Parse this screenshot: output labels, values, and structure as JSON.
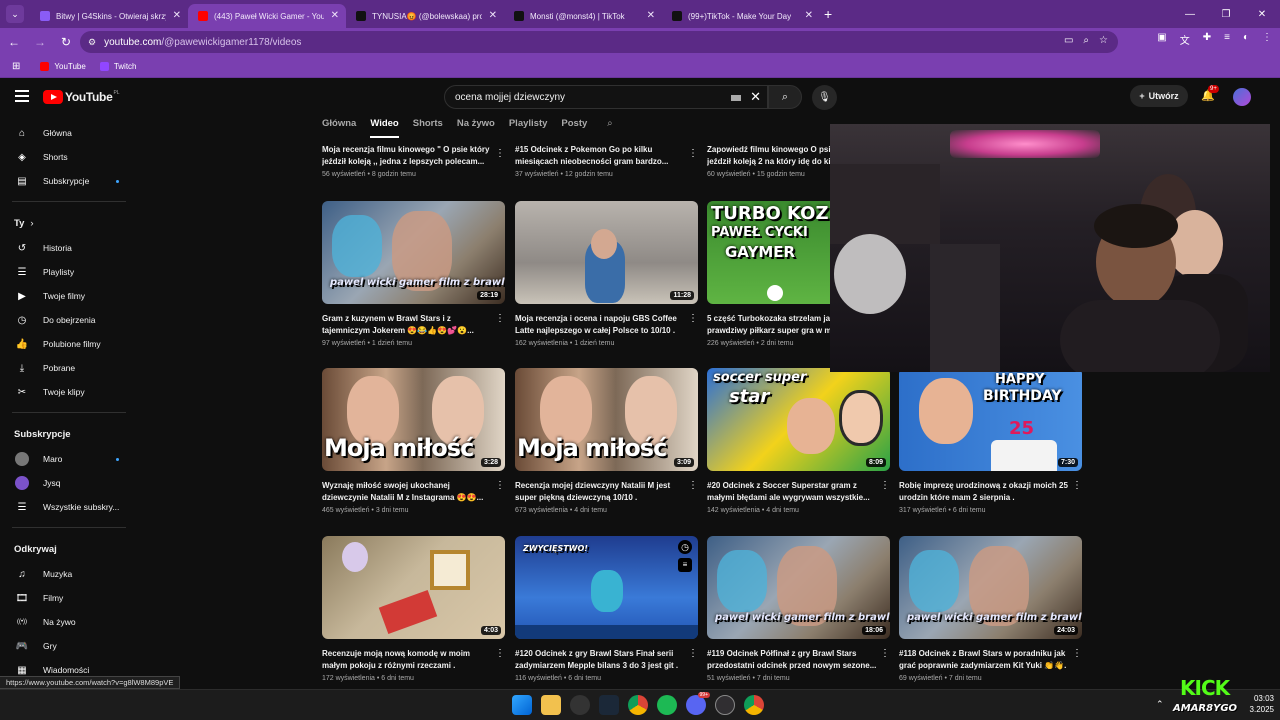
{
  "browser": {
    "tabs": [
      {
        "title": "Bitwy | G4Skins - Otwieraj skrzy",
        "fav_color": "#8a5cf6",
        "active": false
      },
      {
        "title": "(443) Paweł Wicki Gamer - YouT",
        "fav_color": "#ff0000",
        "active": true
      },
      {
        "title": "TYNUSIA😡 (@bolewskaa) pro",
        "fav_color": "#111111",
        "active": false
      },
      {
        "title": "Monsti (@monst4) | TikTok",
        "fav_color": "#111111",
        "active": false
      },
      {
        "title": "(99+)TikTok - Make Your Day",
        "fav_color": "#111111",
        "active": false
      }
    ],
    "new_tab": "+",
    "url_main": "youtube.com",
    "url_path": "/@pawewickigamer1178/videos",
    "bookmarks": [
      {
        "label": "YouTube",
        "color": "#ff0000"
      },
      {
        "label": "Twitch",
        "color": "#9146ff"
      }
    ]
  },
  "header": {
    "logo": "YouTube",
    "country": "PL",
    "search_value": "ocena mojjej dziewczyny",
    "create_label": "Utwórz",
    "notif_badge": "9+"
  },
  "sidebar": {
    "main": [
      {
        "label": "Główna",
        "icon": "⌂"
      },
      {
        "label": "Shorts",
        "icon": "◈"
      },
      {
        "label": "Subskrypcje",
        "icon": "▤"
      }
    ],
    "you_header": "Ty",
    "you": [
      {
        "label": "Historia",
        "icon": "↺"
      },
      {
        "label": "Playlisty",
        "icon": "☰"
      },
      {
        "label": "Twoje filmy",
        "icon": "▶"
      },
      {
        "label": "Do obejrzenia",
        "icon": "◷"
      },
      {
        "label": "Polubione filmy",
        "icon": "👍"
      },
      {
        "label": "Pobrane",
        "icon": "⤓"
      },
      {
        "label": "Twoje klipy",
        "icon": "✂"
      }
    ],
    "subs_header": "Subskrypcje",
    "subs": [
      {
        "label": "Maro",
        "color": "#777777"
      },
      {
        "label": "Jysq",
        "color": "#7b52c9"
      },
      {
        "label": "Wszystkie subskry...",
        "color": ""
      }
    ],
    "explore_header": "Odkrywaj",
    "explore": [
      {
        "label": "Muzyka",
        "icon": "♫"
      },
      {
        "label": "Filmy",
        "icon": "🎞"
      },
      {
        "label": "Na żywo",
        "icon": "((•))"
      },
      {
        "label": "Gry",
        "icon": "🎮"
      },
      {
        "label": "Wiadomości",
        "icon": "▦"
      },
      {
        "label": "Sport",
        "icon": "🏆"
      }
    ]
  },
  "channel_tabs": [
    "Główna",
    "Wideo",
    "Shorts",
    "Na żywo",
    "Playlisty",
    "Posty"
  ],
  "videos": [
    {
      "title": "Moja recenzja filmu kinowego \" O psie który jeździł koleją ,, jedna z lepszych polecam...",
      "views": "56 wyświetleń",
      "age": "8 godzin temu",
      "duration": ""
    },
    {
      "title": "#15 Odcinek z Pokemon Go po kilku miesiącach nieobecności gram bardzo...",
      "views": "37 wyświetleń",
      "age": "12 godzin temu",
      "duration": ""
    },
    {
      "title": "Zapowiedź filmu kinowego O psie który jeździł koleją 2 na który idę do ki...",
      "views": "60 wyświetleń",
      "age": "15 godzin temu",
      "duration": ""
    },
    {
      "title": "Gram z kuzynem w Brawl Stars i z tajemniczym Jokerem 😍😂👍😍💕😮...",
      "views": "97 wyświetleń",
      "age": "1 dzień temu",
      "duration": "28:19"
    },
    {
      "title": "Moja recenzja i ocena i napoju GBS Coffee Latte najlepszego w całej Polsce to 10/10 .",
      "views": "162 wyświetlenia",
      "age": "1 dzień temu",
      "duration": "11:28"
    },
    {
      "title": "5 część Turbokozaka strzelam jak prawdziwy piłkarz super gra w m...",
      "views": "226 wyświetleń",
      "age": "2 dni temu",
      "duration": ""
    },
    {
      "title": "Wyznaję miłość swojej ukochanej dziewczynie Natalii M z Instagrama 😍😍...",
      "views": "465 wyświetleń",
      "age": "3 dni temu",
      "duration": "3:28"
    },
    {
      "title": "Recenzja mojej dziewczyny Natalii M jest super piękną dziewczyną 10/10 .",
      "views": "673 wyświetlenia",
      "age": "4 dni temu",
      "duration": "3:09"
    },
    {
      "title": "#20 Odcinek z Soccer Superstar gram z małymi błędami ale wygrywam wszystkie...",
      "views": "142 wyświetlenia",
      "age": "4 dni temu",
      "duration": "8:09"
    },
    {
      "title": "Robię imprezę urodzinową z okazji moich 25 urodzin które mam 2 sierpnia .",
      "views": "317 wyświetleń",
      "age": "6 dni temu",
      "duration": "7:30"
    },
    {
      "title": "Recenzuje moją nową komodę w moim małym pokoju z różnymi rzeczami .",
      "views": "172 wyświetlenia",
      "age": "6 dni temu",
      "duration": "4:03"
    },
    {
      "title": "#120 Odcinek z gry Brawl Stars Finał serii zadymiarzem Mepple bilans 3 do 3 jest git .",
      "views": "116 wyświetleń",
      "age": "6 dni temu",
      "duration": ""
    },
    {
      "title": "#119 Odcinek Półfinał z gry Brawl Stars przedostatni odcinek przed nowym sezone...",
      "views": "51 wyświetleń",
      "age": "7 dni temu",
      "duration": "18:06"
    },
    {
      "title": "#118 Odcinek z Brawl Stars w poradniku jak grać poprawnie zadymiarzem Kit Yuki 👏👋.",
      "views": "69 wyświetleń",
      "age": "7 dni temu",
      "duration": "24:03"
    }
  ],
  "thumb_text": {
    "wicki": "pawel wicki gamer film z brawl",
    "love": "Moja miłość",
    "turbo1": "TURBO KOZ",
    "turbo2": "PAWEŁ CYCKI",
    "turbo3": "GAYMER",
    "soccer1": "soccer super",
    "soccer2": "star",
    "bday1": "HAPPY",
    "bday2": "BIRTHDAY",
    "bday3": "25",
    "win": "ZWYCIĘSTWO!"
  },
  "status_url": "https://www.youtube.com/watch?v=g8lW8M89pVE",
  "taskbar": {
    "time": "03:03",
    "date": "3.2025",
    "badge_discord": "99+"
  },
  "overlay": {
    "kick": "KICK",
    "name": "AMAR8YGO"
  },
  "colors": {
    "browser_frame": "#7a3fb0",
    "youtube_red": "#ff0000",
    "background": "#0f0f0f",
    "kick_green": "#53fc18"
  }
}
